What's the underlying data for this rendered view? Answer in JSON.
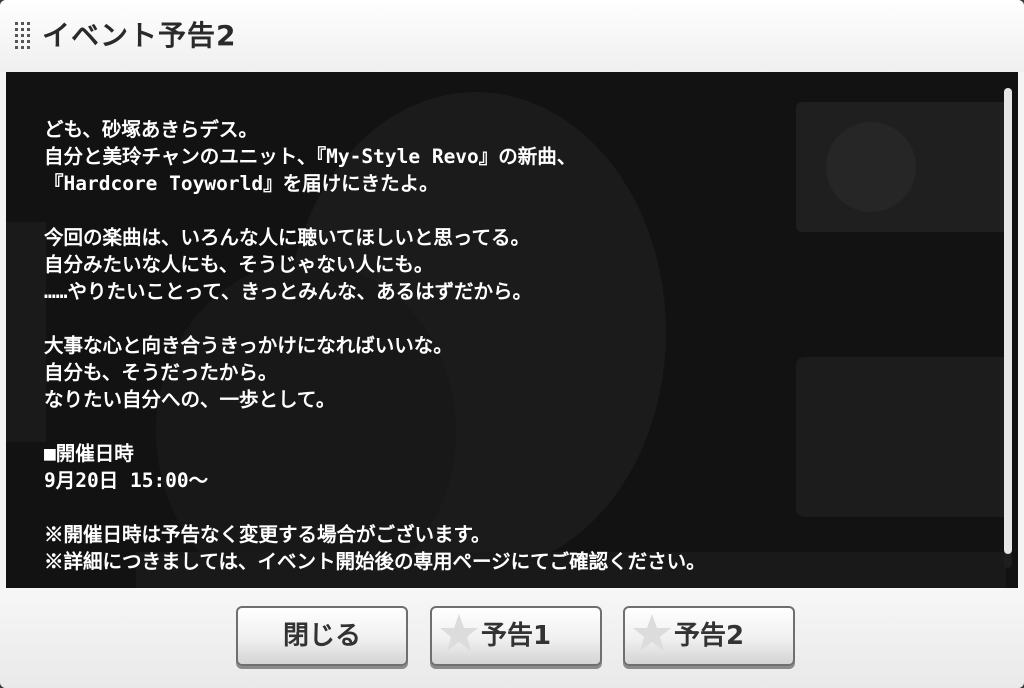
{
  "dialog": {
    "title": "イベント予告2"
  },
  "message": {
    "lines": [
      "ども、砂塚あきらデス。",
      "自分と美玲チャンのユニット、『My-Style Revo』の新曲、",
      "『Hardcore Toyworld』を届けにきたよ。",
      "",
      "今回の楽曲は、いろんな人に聴いてほしいと思ってる。",
      "自分みたいな人にも、そうじゃない人にも。",
      "……やりたいことって、きっとみんな、あるはずだから。",
      "",
      "大事な心と向き合うきっかけになればいいな。",
      "自分も、そうだったから。",
      "なりたい自分への、一歩として。",
      "",
      "■開催日時",
      "9月20日 15:00～",
      "",
      "※開催日時は予告なく変更する場合がございます。",
      "※詳細につきましては、イベント開始後の専用ページにてご確認ください。"
    ]
  },
  "buttons": {
    "close": "閉じる",
    "preview1": "予告1",
    "preview2": "予告2"
  },
  "scroll": {
    "thumb_fraction": 0.97
  },
  "colors": {
    "panel_bg": "#111111",
    "text": "#ffffff",
    "title_text": "#2a2a2a",
    "button_border": "#6f6f6f"
  },
  "icons": {
    "title": "grip-dots-icon",
    "button_decoration": "star-icon"
  }
}
